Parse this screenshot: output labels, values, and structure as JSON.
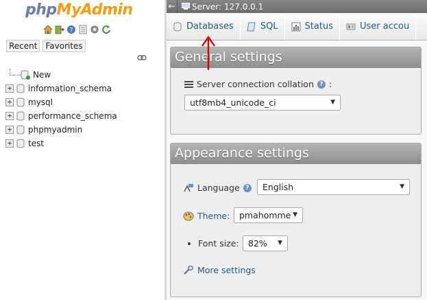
{
  "logo": {
    "part1": "php",
    "part2": "MyAdmin"
  },
  "nav_tabs": {
    "recent": "Recent",
    "favorites": "Favorites"
  },
  "tree": [
    {
      "label": "New",
      "expandable": false
    },
    {
      "label": "information_schema",
      "expandable": true
    },
    {
      "label": "mysql",
      "expandable": true
    },
    {
      "label": "performance_schema",
      "expandable": true
    },
    {
      "label": "phpmyadmin",
      "expandable": true
    },
    {
      "label": "test",
      "expandable": true
    }
  ],
  "topbar": {
    "back": "←",
    "server": "Server: 127.0.0.1"
  },
  "menu": {
    "databases": "Databases",
    "sql": "SQL",
    "status": "Status",
    "user_accounts": "User accou"
  },
  "general": {
    "title": "General settings",
    "collation_label": "Server connection collation",
    "collation_suffix": ":",
    "collation_value": "utf8mb4_unicode_ci"
  },
  "appearance": {
    "title": "Appearance settings",
    "language_label": "Language",
    "language_value": "English",
    "theme_label": "Theme:",
    "theme_value": "pmahomme",
    "fontsize_label": "Font size:",
    "fontsize_value": "82%",
    "more_settings": "More settings"
  },
  "colors": {
    "accent": "#235a81",
    "annotation": "#e00000",
    "logo_php": "#6c78af",
    "logo_admin": "#f89c0e"
  }
}
